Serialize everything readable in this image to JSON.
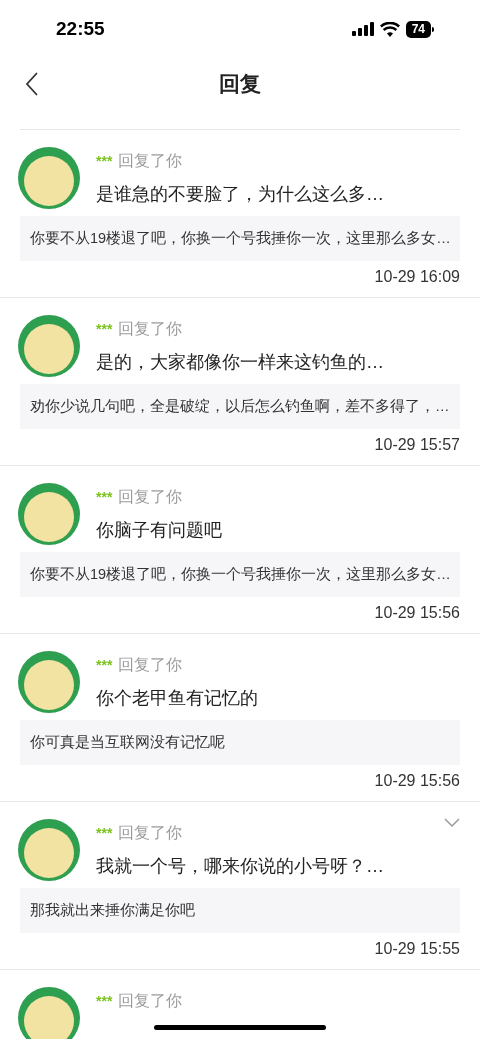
{
  "status_bar": {
    "time": "22:55",
    "battery": "74"
  },
  "nav": {
    "title": "回复"
  },
  "replies": [
    {
      "user": "***",
      "action": "回复了你",
      "text": "是谁急的不要脸了，为什么这么多…",
      "quote": "你要不从19楼退了吧，你换一个号我捶你一次，这里那么多女…",
      "time": "10-29 16:09",
      "has_menu": false
    },
    {
      "user": "***",
      "action": "回复了你",
      "text": "是的，大家都像你一样来这钓鱼的…",
      "quote": "劝你少说几句吧，全是破绽，以后怎么钓鱼啊，差不多得了，…",
      "time": "10-29 15:57",
      "has_menu": false
    },
    {
      "user": "***",
      "action": "回复了你",
      "text": "你脑子有问题吧",
      "quote": "你要不从19楼退了吧，你换一个号我捶你一次，这里那么多女…",
      "time": "10-29 15:56",
      "has_menu": false
    },
    {
      "user": "***",
      "action": "回复了你",
      "text": "你个老甲鱼有记忆的",
      "quote": "你可真是当互联网没有记忆呢",
      "time": "10-29 15:56",
      "has_menu": false
    },
    {
      "user": "***",
      "action": "回复了你",
      "text": "我就一个号，哪来你说的小号呀？…",
      "quote": "那我就出来捶你满足你吧",
      "time": "10-29 15:55",
      "has_menu": true
    },
    {
      "user": "***",
      "action": "回复了你",
      "has_menu": false
    }
  ]
}
